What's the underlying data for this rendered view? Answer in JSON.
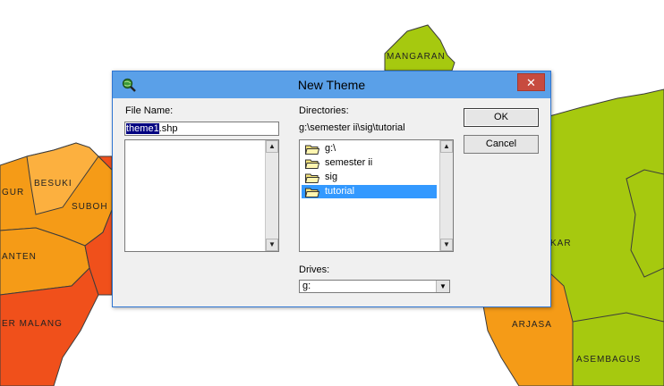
{
  "map": {
    "labels": [
      "MANGARAN",
      "GUR",
      "BESUKI",
      "SUBOH",
      "ANTEN",
      "ER MALANG",
      "KAR",
      "ARJASA",
      "ASEMBAGUS"
    ],
    "colors": {
      "orange": "#f59b17",
      "light_orange": "#fcb03f",
      "red": "#f0501b",
      "green": "#a6c90f",
      "border": "#3c3c3c"
    }
  },
  "dialog": {
    "title": "New Theme",
    "title_icon": "magnifier-globe-icon",
    "close_label": "✕",
    "file_name": {
      "label": "File Name:",
      "value_selected": "theme1",
      "value_rest": ".shp"
    },
    "directories": {
      "label": "Directories:",
      "path": "g:\\semester ii\\sig\\tutorial",
      "items": [
        {
          "label": "g:\\",
          "selected": false
        },
        {
          "label": "semester ii",
          "selected": false
        },
        {
          "label": "sig",
          "selected": false
        },
        {
          "label": "tutorial",
          "selected": true
        }
      ]
    },
    "drives": {
      "label": "Drives:",
      "value": "g:"
    },
    "buttons": {
      "ok": "OK",
      "cancel": "Cancel"
    },
    "accent": "#5aa0e8",
    "selection_color": "#3399ff"
  }
}
